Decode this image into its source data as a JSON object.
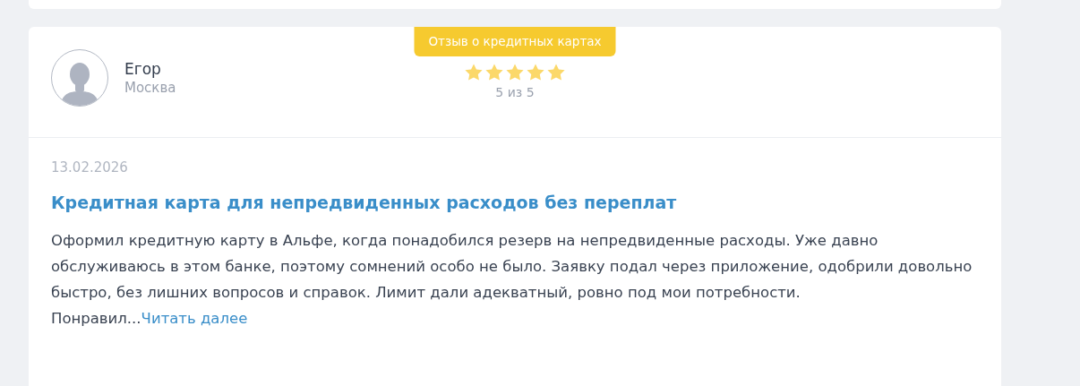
{
  "review": {
    "category_badge": "Отзыв о кредитных картах",
    "author": {
      "name": "Егор",
      "city": "Москва"
    },
    "rating": {
      "stars": 5,
      "caption": "5 из 5"
    },
    "date": "13.02.2026",
    "title": "Кредитная карта для непредвиденных расходов без переплат",
    "text": "Оформил кредитную карту в Альфе, когда понадобился резерв на непредвиденные расходы. Уже давно обслуживаюсь в этом банке, поэтому сомнений особо не было. Заявку подал через приложение, одобрили довольно быстро, без лишних вопросов и справок. Лимит дали адекватный, ровно под мои потребности. Понравил...",
    "read_more": "Читать далее"
  }
}
